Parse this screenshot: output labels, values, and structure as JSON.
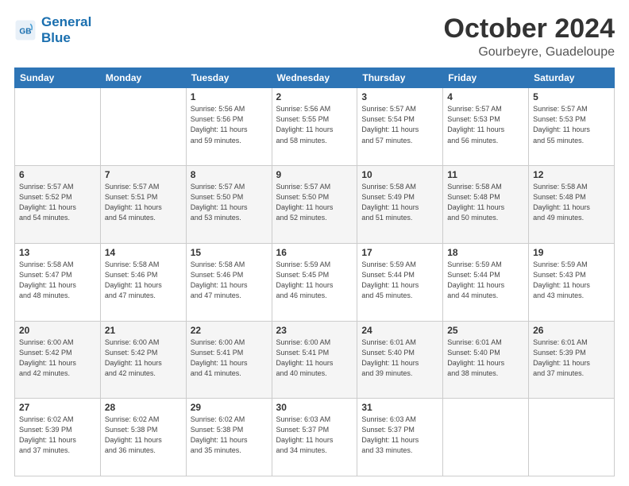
{
  "header": {
    "logo_line1": "General",
    "logo_line2": "Blue",
    "title": "October 2024",
    "subtitle": "Gourbeyre, Guadeloupe"
  },
  "weekdays": [
    "Sunday",
    "Monday",
    "Tuesday",
    "Wednesday",
    "Thursday",
    "Friday",
    "Saturday"
  ],
  "weeks": [
    [
      {
        "day": "",
        "info": ""
      },
      {
        "day": "",
        "info": ""
      },
      {
        "day": "1",
        "info": "Sunrise: 5:56 AM\nSunset: 5:56 PM\nDaylight: 11 hours\nand 59 minutes."
      },
      {
        "day": "2",
        "info": "Sunrise: 5:56 AM\nSunset: 5:55 PM\nDaylight: 11 hours\nand 58 minutes."
      },
      {
        "day": "3",
        "info": "Sunrise: 5:57 AM\nSunset: 5:54 PM\nDaylight: 11 hours\nand 57 minutes."
      },
      {
        "day": "4",
        "info": "Sunrise: 5:57 AM\nSunset: 5:53 PM\nDaylight: 11 hours\nand 56 minutes."
      },
      {
        "day": "5",
        "info": "Sunrise: 5:57 AM\nSunset: 5:53 PM\nDaylight: 11 hours\nand 55 minutes."
      }
    ],
    [
      {
        "day": "6",
        "info": "Sunrise: 5:57 AM\nSunset: 5:52 PM\nDaylight: 11 hours\nand 54 minutes."
      },
      {
        "day": "7",
        "info": "Sunrise: 5:57 AM\nSunset: 5:51 PM\nDaylight: 11 hours\nand 54 minutes."
      },
      {
        "day": "8",
        "info": "Sunrise: 5:57 AM\nSunset: 5:50 PM\nDaylight: 11 hours\nand 53 minutes."
      },
      {
        "day": "9",
        "info": "Sunrise: 5:57 AM\nSunset: 5:50 PM\nDaylight: 11 hours\nand 52 minutes."
      },
      {
        "day": "10",
        "info": "Sunrise: 5:58 AM\nSunset: 5:49 PM\nDaylight: 11 hours\nand 51 minutes."
      },
      {
        "day": "11",
        "info": "Sunrise: 5:58 AM\nSunset: 5:48 PM\nDaylight: 11 hours\nand 50 minutes."
      },
      {
        "day": "12",
        "info": "Sunrise: 5:58 AM\nSunset: 5:48 PM\nDaylight: 11 hours\nand 49 minutes."
      }
    ],
    [
      {
        "day": "13",
        "info": "Sunrise: 5:58 AM\nSunset: 5:47 PM\nDaylight: 11 hours\nand 48 minutes."
      },
      {
        "day": "14",
        "info": "Sunrise: 5:58 AM\nSunset: 5:46 PM\nDaylight: 11 hours\nand 47 minutes."
      },
      {
        "day": "15",
        "info": "Sunrise: 5:58 AM\nSunset: 5:46 PM\nDaylight: 11 hours\nand 47 minutes."
      },
      {
        "day": "16",
        "info": "Sunrise: 5:59 AM\nSunset: 5:45 PM\nDaylight: 11 hours\nand 46 minutes."
      },
      {
        "day": "17",
        "info": "Sunrise: 5:59 AM\nSunset: 5:44 PM\nDaylight: 11 hours\nand 45 minutes."
      },
      {
        "day": "18",
        "info": "Sunrise: 5:59 AM\nSunset: 5:44 PM\nDaylight: 11 hours\nand 44 minutes."
      },
      {
        "day": "19",
        "info": "Sunrise: 5:59 AM\nSunset: 5:43 PM\nDaylight: 11 hours\nand 43 minutes."
      }
    ],
    [
      {
        "day": "20",
        "info": "Sunrise: 6:00 AM\nSunset: 5:42 PM\nDaylight: 11 hours\nand 42 minutes."
      },
      {
        "day": "21",
        "info": "Sunrise: 6:00 AM\nSunset: 5:42 PM\nDaylight: 11 hours\nand 42 minutes."
      },
      {
        "day": "22",
        "info": "Sunrise: 6:00 AM\nSunset: 5:41 PM\nDaylight: 11 hours\nand 41 minutes."
      },
      {
        "day": "23",
        "info": "Sunrise: 6:00 AM\nSunset: 5:41 PM\nDaylight: 11 hours\nand 40 minutes."
      },
      {
        "day": "24",
        "info": "Sunrise: 6:01 AM\nSunset: 5:40 PM\nDaylight: 11 hours\nand 39 minutes."
      },
      {
        "day": "25",
        "info": "Sunrise: 6:01 AM\nSunset: 5:40 PM\nDaylight: 11 hours\nand 38 minutes."
      },
      {
        "day": "26",
        "info": "Sunrise: 6:01 AM\nSunset: 5:39 PM\nDaylight: 11 hours\nand 37 minutes."
      }
    ],
    [
      {
        "day": "27",
        "info": "Sunrise: 6:02 AM\nSunset: 5:39 PM\nDaylight: 11 hours\nand 37 minutes."
      },
      {
        "day": "28",
        "info": "Sunrise: 6:02 AM\nSunset: 5:38 PM\nDaylight: 11 hours\nand 36 minutes."
      },
      {
        "day": "29",
        "info": "Sunrise: 6:02 AM\nSunset: 5:38 PM\nDaylight: 11 hours\nand 35 minutes."
      },
      {
        "day": "30",
        "info": "Sunrise: 6:03 AM\nSunset: 5:37 PM\nDaylight: 11 hours\nand 34 minutes."
      },
      {
        "day": "31",
        "info": "Sunrise: 6:03 AM\nSunset: 5:37 PM\nDaylight: 11 hours\nand 33 minutes."
      },
      {
        "day": "",
        "info": ""
      },
      {
        "day": "",
        "info": ""
      }
    ]
  ]
}
